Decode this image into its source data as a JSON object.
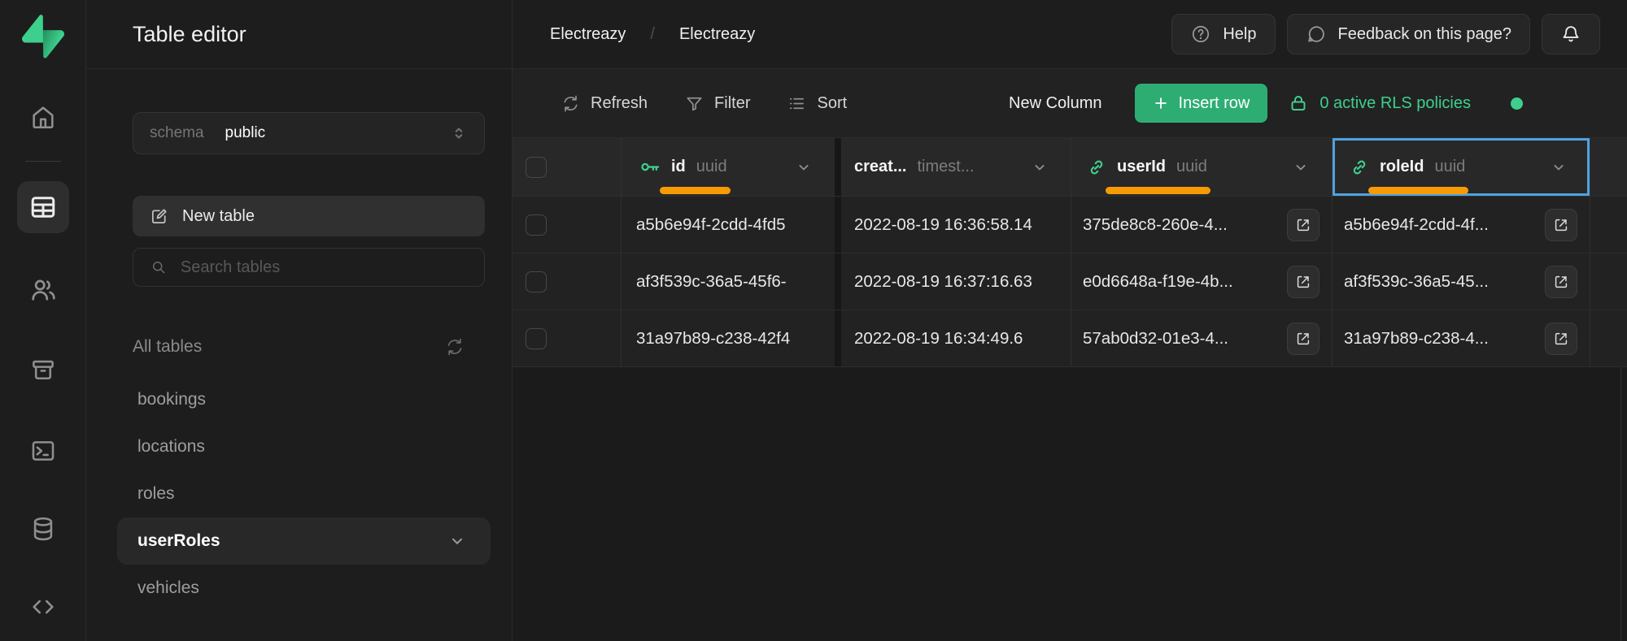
{
  "colors": {
    "green": "#3ECF8E",
    "green-btn": "#2EAD73",
    "orange": "#F79B04",
    "blue": "#4FA2DF"
  },
  "sidebar": {
    "title": "Table editor",
    "schema_label": "schema",
    "schema_value": "public",
    "new_table_label": "New table",
    "search_placeholder": "Search tables",
    "all_tables_label": "All tables",
    "tables": [
      {
        "name": "bookings"
      },
      {
        "name": "locations"
      },
      {
        "name": "roles"
      },
      {
        "name": "userRoles",
        "selected": true
      },
      {
        "name": "vehicles"
      }
    ]
  },
  "header": {
    "breadcrumb": {
      "project": "Electreazy",
      "separator": "/",
      "page": "Electreazy"
    },
    "help_label": "Help",
    "feedback_label": "Feedback on this page?"
  },
  "toolbar": {
    "refresh_label": "Refresh",
    "filter_label": "Filter",
    "sort_label": "Sort",
    "new_column_label": "New Column",
    "insert_row_label": "Insert row",
    "rls_label": "0 active RLS policies"
  },
  "grid": {
    "columns": [
      {
        "name": "id",
        "type": "uuid",
        "icon": "primary-key",
        "underlined": true
      },
      {
        "name": "creat...",
        "type": "timest...",
        "icon": "none",
        "underlined": false
      },
      {
        "name": "userId",
        "type": "uuid",
        "icon": "foreign-key-link",
        "underlined": true
      },
      {
        "name": "roleId",
        "type": "uuid",
        "icon": "foreign-key-link",
        "underlined": true,
        "selected": true
      }
    ],
    "rows": [
      {
        "id": "a5b6e94f-2cdd-4fd5",
        "created_at": "2022-08-19 16:36:58.14",
        "userId": "375de8c8-260e-4...",
        "roleId": "a5b6e94f-2cdd-4f..."
      },
      {
        "id": "af3f539c-36a5-45f6-",
        "created_at": "2022-08-19 16:37:16.63",
        "userId": "e0d6648a-f19e-4b...",
        "roleId": "af3f539c-36a5-45..."
      },
      {
        "id": "31a97b89-c238-42f4",
        "created_at": "2022-08-19 16:34:49.6",
        "userId": "57ab0d32-01e3-4...",
        "roleId": "31a97b89-c238-4..."
      }
    ]
  }
}
